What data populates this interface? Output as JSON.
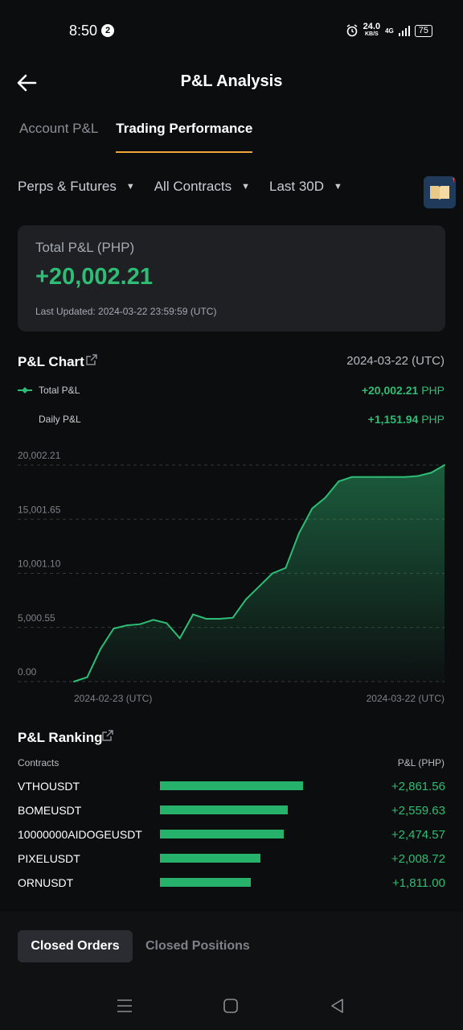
{
  "status_bar": {
    "time": "8:50",
    "notification_count": "2",
    "speed_value": "24.0",
    "speed_unit": "KB/S",
    "network": "4G",
    "battery": "75"
  },
  "header": {
    "title": "P&L Analysis"
  },
  "tabs": [
    {
      "label": "Account P&L",
      "active": false
    },
    {
      "label": "Trading Performance",
      "active": true
    }
  ],
  "filters": {
    "product": "Perps & Futures",
    "contracts": "All Contracts",
    "period": "Last 30D"
  },
  "summary": {
    "label": "Total P&L (PHP)",
    "value": "+20,002.21",
    "updated": "Last Updated: 2024-03-22 23:59:59 (UTC)"
  },
  "pnl_chart": {
    "title": "P&L Chart",
    "date": "2024-03-22 (UTC)",
    "legend_total_label": "Total P&L",
    "legend_total_value": "+20,002.21",
    "legend_daily_label": "Daily P&L",
    "legend_daily_value": "+1,151.94",
    "currency": "PHP"
  },
  "chart_data": {
    "type": "area",
    "yticks": [
      "20,002.21",
      "15,001.65",
      "10,001.10",
      "5,000.55",
      "0.00"
    ],
    "ylim": [
      0,
      20002.21
    ],
    "xlabels": [
      "2024-02-23 (UTC)",
      "2024-03-22 (UTC)"
    ],
    "series": [
      {
        "name": "Total P&L",
        "color": "#2ebd75",
        "x": [
          "2024-02-23",
          "2024-02-24",
          "2024-02-25",
          "2024-02-26",
          "2024-02-27",
          "2024-02-28",
          "2024-02-29",
          "2024-03-01",
          "2024-03-02",
          "2024-03-03",
          "2024-03-04",
          "2024-03-05",
          "2024-03-06",
          "2024-03-07",
          "2024-03-08",
          "2024-03-09",
          "2024-03-10",
          "2024-03-11",
          "2024-03-12",
          "2024-03-13",
          "2024-03-14",
          "2024-03-15",
          "2024-03-16",
          "2024-03-17",
          "2024-03-18",
          "2024-03-19",
          "2024-03-20",
          "2024-03-21",
          "2024-03-22"
        ],
        "values": [
          0,
          400,
          3000,
          4900,
          5200,
          5300,
          5700,
          5400,
          4000,
          6200,
          5800,
          5800,
          5900,
          7600,
          8800,
          10000,
          10500,
          13700,
          16000,
          17000,
          18500,
          18900,
          18900,
          18900,
          18900,
          18900,
          19000,
          19300,
          20002.21
        ]
      }
    ],
    "grid": true
  },
  "ranking": {
    "title": "P&L Ranking",
    "col_contracts": "Contracts",
    "col_pnl": "P&L (PHP)",
    "rows": [
      {
        "name": "VTHOUSDT",
        "value": "+2,861.56",
        "amount": 2861.56
      },
      {
        "name": "BOMEUSDT",
        "value": "+2,559.63",
        "amount": 2559.63
      },
      {
        "name": "10000000AIDOGEUSDT",
        "value": "+2,474.57",
        "amount": 2474.57
      },
      {
        "name": "PIXELUSDT",
        "value": "+2,008.72",
        "amount": 2008.72
      },
      {
        "name": "ORNUSDT",
        "value": "+1,811.00",
        "amount": 1811.0
      }
    ]
  },
  "bottom_tabs": {
    "closed_orders": "Closed Orders",
    "closed_positions": "Closed Positions"
  }
}
